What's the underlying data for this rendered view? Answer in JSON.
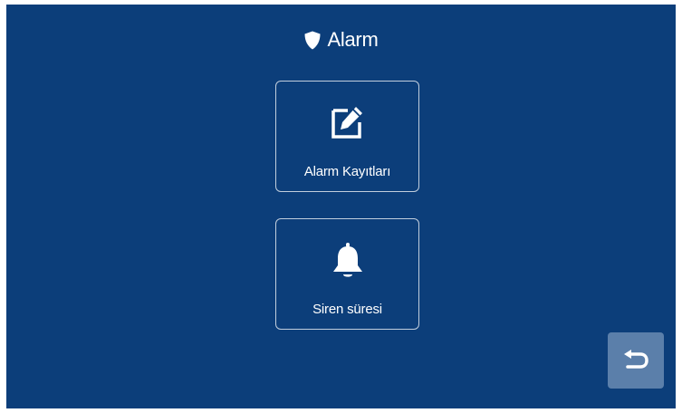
{
  "header": {
    "title": "Alarm",
    "icon": "shield-icon"
  },
  "menu": {
    "items": [
      {
        "label": "Alarm Kayıtları",
        "icon": "edit-icon"
      },
      {
        "label": "Siren süresi",
        "icon": "bell-icon"
      }
    ]
  },
  "back_button": {
    "icon": "return-arrow-icon"
  },
  "colors": {
    "background": "#0c3e7a",
    "tile_border": "#c0cde0",
    "back_button": "#5b7faa",
    "text": "#ffffff"
  }
}
